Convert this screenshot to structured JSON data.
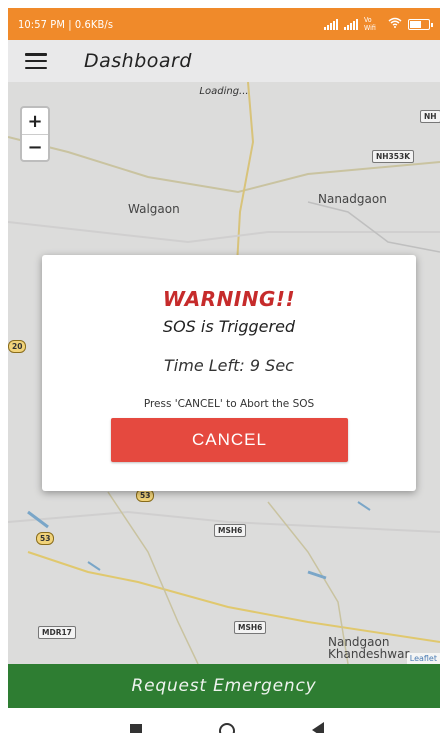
{
  "status_bar": {
    "time_speed": "10:57 PM | 0.6KB/s",
    "network": "Vo Wifi",
    "colors": {
      "background": "#f08a2a"
    }
  },
  "app_bar": {
    "title": "Dashboard",
    "menu_icon": "menu-icon"
  },
  "map": {
    "loading_text": "Loading...",
    "zoom_in": "+",
    "zoom_out": "−",
    "places": [
      "Walgaon",
      "Nanadgaon",
      "Nandgaon Khandeshwar"
    ],
    "roads": [
      "NH",
      "NH353K",
      "MSH6",
      "MSH6",
      "MDR17",
      "53",
      "53",
      "20"
    ],
    "attribution": "Leaflet"
  },
  "dialog": {
    "warning": "WARNING!!",
    "sos_message": "SOS is Triggered",
    "time_left": "Time Left: 9 Sec",
    "abort_hint": "Press 'CANCEL' to Abort the SOS",
    "cancel_label": "CANCEL",
    "colors": {
      "warning_text": "#c62b2b",
      "cancel_button": "#e5493f"
    }
  },
  "bottom": {
    "request_label": "Request Emergency",
    "colors": {
      "button": "#2e7d32"
    }
  },
  "nav": {
    "icons": [
      "recent-apps-icon",
      "home-icon",
      "back-icon"
    ]
  }
}
